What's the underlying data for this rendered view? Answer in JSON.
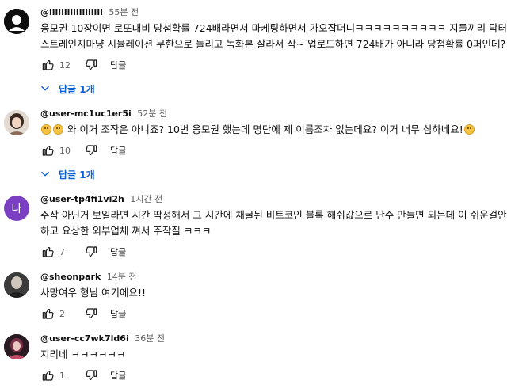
{
  "comments": [
    {
      "author": "@ilililillilillilll",
      "time": "55분 전",
      "lines": [
        "응모권 10장이면 로또대비 당첨확률 724배라면서 마케팅하면서 가오잡더니ㅋㅋㅋㅋㅋㅋㅋㅋㅋㅋ 지들끼리 닥터",
        "스트레인지마냥 시뮬레이션 무한으로 돌리고 녹화본 잘라서 삭~ 업로드하면 724배가 아니라 당첨확률 0퍼인데?"
      ],
      "likes": "12",
      "reply_label": "답글",
      "replies_label": "답글 1개"
    },
    {
      "author": "@user-mc1uc1er5i",
      "time": "52분 전",
      "text_pre": "",
      "text_main": " 와 이거 조작은 아니죠? 10번 응모권 했는데 명단에 제 이름조차 없는데요? 이거 너무 심하네요!",
      "likes": "10",
      "reply_label": "답글",
      "replies_label": "답글 1개"
    },
    {
      "author": "@user-tp4fi1vi2h",
      "time": "1시간 전",
      "avatar_letter": "나",
      "lines": [
        "주작 아닌거 보일라면 시간 딱정해서 그 시간에 채굴된 비트코인 블록 해쉬값으로 난수 만들면 되는데 이 쉬운걸안",
        "하고 요상한 외부업체 껴서 주작질 ㅋㅋㅋ"
      ],
      "likes": "7",
      "reply_label": "답글"
    },
    {
      "author": "@sheonpark",
      "time": "14분 전",
      "lines": [
        "사망여우 형님 여기에요!!"
      ],
      "likes": "2",
      "reply_label": "답글"
    },
    {
      "author": "@user-cc7wk7ld6i",
      "time": "36분 전",
      "lines": [
        "지리네 ㅋㅋㅋㅋㅋㅋ"
      ],
      "likes": "1",
      "reply_label": "답글"
    }
  ],
  "colors": {
    "link_blue": "#065fd4",
    "avatar_purple": "#7b3fc4"
  }
}
